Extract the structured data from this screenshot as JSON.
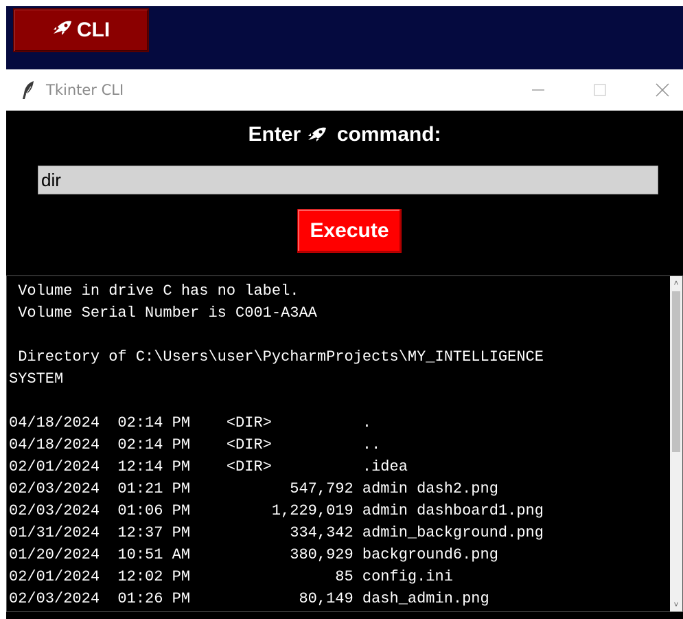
{
  "top_bar": {
    "cli_button": {
      "icon": "rocket-icon",
      "label": "CLI"
    }
  },
  "window": {
    "title": "Tkinter CLI",
    "icon": "feather-icon"
  },
  "prompt": {
    "before": "Enter",
    "icon": "rocket-icon",
    "after": "command:"
  },
  "command_input": {
    "value": "dir"
  },
  "execute_button": {
    "label": "Execute"
  },
  "output": {
    "lines": [
      " Volume in drive C has no label.",
      " Volume Serial Number is C001-A3AA",
      "",
      " Directory of C:\\Users\\user\\PycharmProjects\\MY_INTELLIGENCE",
      "SYSTEM",
      "",
      "04/18/2024  02:14 PM    <DIR>          .",
      "04/18/2024  02:14 PM    <DIR>          ..",
      "02/01/2024  12:14 PM    <DIR>          .idea",
      "02/03/2024  01:21 PM           547,792 admin dash2.png",
      "02/03/2024  01:06 PM         1,229,019 admin dashboard1.png",
      "01/31/2024  12:37 PM           334,342 admin_background.png",
      "01/20/2024  10:51 AM           380,929 background6.png",
      "02/01/2024  12:02 PM                85 config.ini",
      "02/03/2024  01:26 PM            80,149 dash_admin.png"
    ]
  },
  "colors": {
    "top_bar": "#050a3f",
    "cli_button": "#8b0000",
    "execute_button": "#ff0000",
    "input_bg": "#d3d3d3",
    "body_bg": "#000000"
  }
}
